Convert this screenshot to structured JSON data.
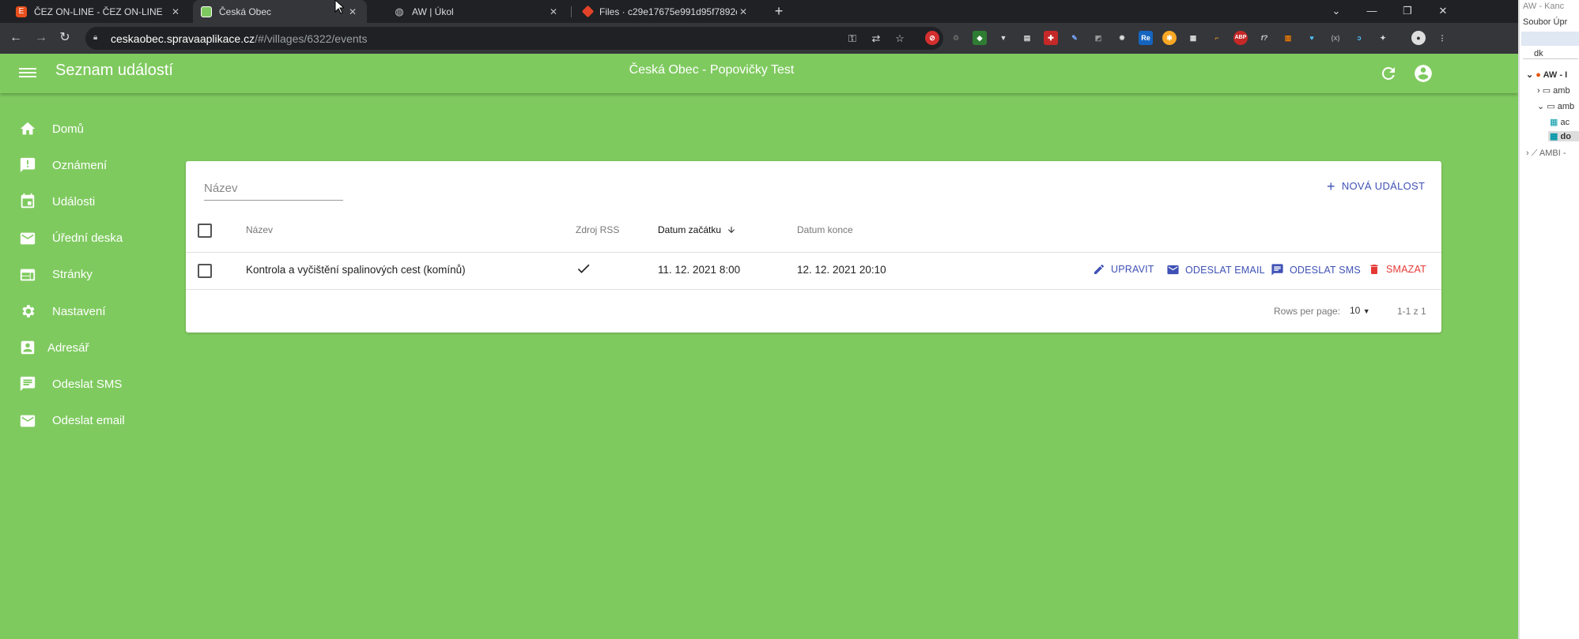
{
  "browser": {
    "tabs": [
      {
        "title": "ČEZ ON-LINE - ČEZ ON-LINE",
        "favicon_color": "#e8501e",
        "active": false
      },
      {
        "title": "Česká Obec",
        "favicon_color": "#7fca5f",
        "active": true
      },
      {
        "title": "AW | Úkol",
        "favicon_color": "#9aa0a6",
        "active": false
      },
      {
        "title": "Files · c29e17675e991d95f7892e",
        "favicon_color": "#e24329",
        "active": false
      }
    ],
    "url_host": "ceskaobec.spravaaplikace.cz",
    "url_rest": "/#/villages/6322/events"
  },
  "app": {
    "page_title": "Seznam událostí",
    "center_title": "Česká Obec - Popovičky Test",
    "accent": "#7fca5f"
  },
  "sidebar": {
    "items": [
      {
        "label": "Domů",
        "icon": "home-icon"
      },
      {
        "label": "Oznámení",
        "icon": "announcement-icon"
      },
      {
        "label": "Události",
        "icon": "calendar-icon"
      },
      {
        "label": "Úřední deska",
        "icon": "mail-icon"
      },
      {
        "label": "Stránky",
        "icon": "web-icon"
      },
      {
        "label": "Nastavení",
        "icon": "gear-icon"
      },
      {
        "label": "Adresář",
        "icon": "contacts-icon"
      },
      {
        "label": "Odeslat SMS",
        "icon": "message-icon"
      },
      {
        "label": "Odeslat email",
        "icon": "mail-icon"
      }
    ]
  },
  "events": {
    "filter_placeholder": "Název",
    "new_button": "NOVÁ UDÁLOST",
    "columns": {
      "name": "Název",
      "rss": "Zdroj RSS",
      "start": "Datum začátku",
      "end": "Datum konce"
    },
    "rows": [
      {
        "name": "Kontrola a vyčištění spalinových cest (komínů)",
        "rss": true,
        "start": "11. 12. 2021 8:00",
        "end": "12. 12. 2021 20:10"
      }
    ],
    "actions": {
      "edit": "UPRAVIT",
      "email": "ODESLAT EMAIL",
      "sms": "ODESLAT SMS",
      "delete": "SMAZAT"
    },
    "pager": {
      "rows_per_page_label": "Rows per page:",
      "rows_per_page": "10",
      "range": "1-1 z 1"
    }
  },
  "side_window": {
    "title": "AW - Kanc",
    "menu": "Soubor  Úpr",
    "search": "dk",
    "tree": [
      "AW - I",
      "amb",
      "amb",
      "ac",
      "do",
      "AMBI -"
    ]
  }
}
